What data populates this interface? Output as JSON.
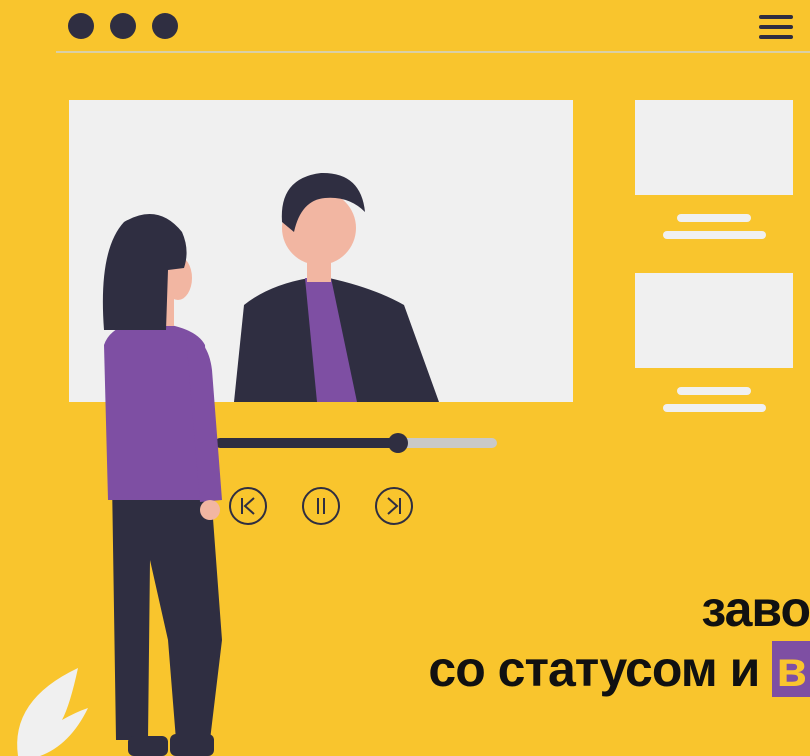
{
  "window": {
    "dots": [
      "dot-1",
      "dot-2",
      "dot-3"
    ],
    "menu_icon": "hamburger-menu-icon"
  },
  "player": {
    "progress": 0.65,
    "controls": {
      "prev_icon": "skip-back-icon",
      "pause_icon": "pause-icon",
      "next_icon": "skip-forward-icon"
    }
  },
  "headline": {
    "line1": "заво",
    "line2_prefix": "со статусом и ",
    "line2_highlight": "в"
  },
  "colors": {
    "background": "#f9c52d",
    "dark": "#2f2e41",
    "accent": "#7e4fa3",
    "panel": "#f0f0f0"
  }
}
